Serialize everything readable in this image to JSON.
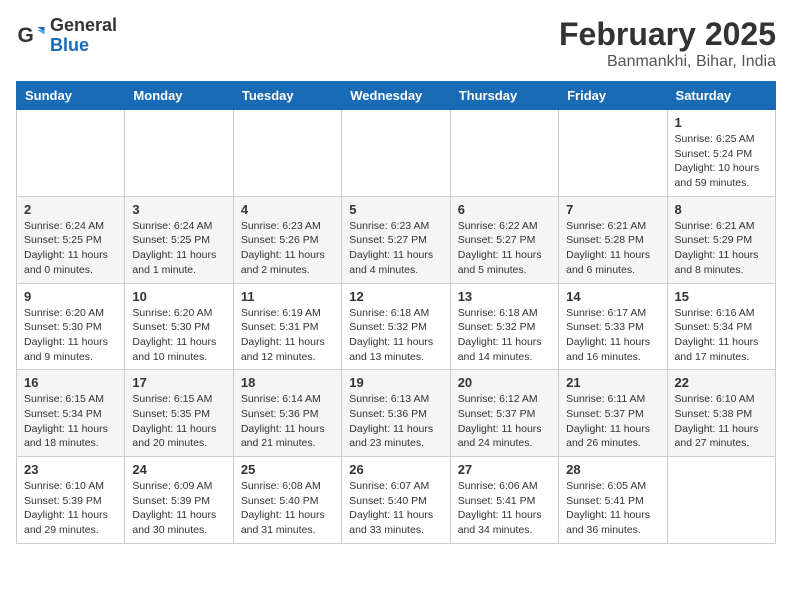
{
  "logo": {
    "general": "General",
    "blue": "Blue"
  },
  "header": {
    "month_year": "February 2025",
    "location": "Banmankhi, Bihar, India"
  },
  "weekdays": [
    "Sunday",
    "Monday",
    "Tuesday",
    "Wednesday",
    "Thursday",
    "Friday",
    "Saturday"
  ],
  "weeks": [
    [
      {
        "day": "",
        "info": ""
      },
      {
        "day": "",
        "info": ""
      },
      {
        "day": "",
        "info": ""
      },
      {
        "day": "",
        "info": ""
      },
      {
        "day": "",
        "info": ""
      },
      {
        "day": "",
        "info": ""
      },
      {
        "day": "1",
        "info": "Sunrise: 6:25 AM\nSunset: 5:24 PM\nDaylight: 10 hours\nand 59 minutes."
      }
    ],
    [
      {
        "day": "2",
        "info": "Sunrise: 6:24 AM\nSunset: 5:25 PM\nDaylight: 11 hours\nand 0 minutes."
      },
      {
        "day": "3",
        "info": "Sunrise: 6:24 AM\nSunset: 5:25 PM\nDaylight: 11 hours\nand 1 minute."
      },
      {
        "day": "4",
        "info": "Sunrise: 6:23 AM\nSunset: 5:26 PM\nDaylight: 11 hours\nand 2 minutes."
      },
      {
        "day": "5",
        "info": "Sunrise: 6:23 AM\nSunset: 5:27 PM\nDaylight: 11 hours\nand 4 minutes."
      },
      {
        "day": "6",
        "info": "Sunrise: 6:22 AM\nSunset: 5:27 PM\nDaylight: 11 hours\nand 5 minutes."
      },
      {
        "day": "7",
        "info": "Sunrise: 6:21 AM\nSunset: 5:28 PM\nDaylight: 11 hours\nand 6 minutes."
      },
      {
        "day": "8",
        "info": "Sunrise: 6:21 AM\nSunset: 5:29 PM\nDaylight: 11 hours\nand 8 minutes."
      }
    ],
    [
      {
        "day": "9",
        "info": "Sunrise: 6:20 AM\nSunset: 5:30 PM\nDaylight: 11 hours\nand 9 minutes."
      },
      {
        "day": "10",
        "info": "Sunrise: 6:20 AM\nSunset: 5:30 PM\nDaylight: 11 hours\nand 10 minutes."
      },
      {
        "day": "11",
        "info": "Sunrise: 6:19 AM\nSunset: 5:31 PM\nDaylight: 11 hours\nand 12 minutes."
      },
      {
        "day": "12",
        "info": "Sunrise: 6:18 AM\nSunset: 5:32 PM\nDaylight: 11 hours\nand 13 minutes."
      },
      {
        "day": "13",
        "info": "Sunrise: 6:18 AM\nSunset: 5:32 PM\nDaylight: 11 hours\nand 14 minutes."
      },
      {
        "day": "14",
        "info": "Sunrise: 6:17 AM\nSunset: 5:33 PM\nDaylight: 11 hours\nand 16 minutes."
      },
      {
        "day": "15",
        "info": "Sunrise: 6:16 AM\nSunset: 5:34 PM\nDaylight: 11 hours\nand 17 minutes."
      }
    ],
    [
      {
        "day": "16",
        "info": "Sunrise: 6:15 AM\nSunset: 5:34 PM\nDaylight: 11 hours\nand 18 minutes."
      },
      {
        "day": "17",
        "info": "Sunrise: 6:15 AM\nSunset: 5:35 PM\nDaylight: 11 hours\nand 20 minutes."
      },
      {
        "day": "18",
        "info": "Sunrise: 6:14 AM\nSunset: 5:36 PM\nDaylight: 11 hours\nand 21 minutes."
      },
      {
        "day": "19",
        "info": "Sunrise: 6:13 AM\nSunset: 5:36 PM\nDaylight: 11 hours\nand 23 minutes."
      },
      {
        "day": "20",
        "info": "Sunrise: 6:12 AM\nSunset: 5:37 PM\nDaylight: 11 hours\nand 24 minutes."
      },
      {
        "day": "21",
        "info": "Sunrise: 6:11 AM\nSunset: 5:37 PM\nDaylight: 11 hours\nand 26 minutes."
      },
      {
        "day": "22",
        "info": "Sunrise: 6:10 AM\nSunset: 5:38 PM\nDaylight: 11 hours\nand 27 minutes."
      }
    ],
    [
      {
        "day": "23",
        "info": "Sunrise: 6:10 AM\nSunset: 5:39 PM\nDaylight: 11 hours\nand 29 minutes."
      },
      {
        "day": "24",
        "info": "Sunrise: 6:09 AM\nSunset: 5:39 PM\nDaylight: 11 hours\nand 30 minutes."
      },
      {
        "day": "25",
        "info": "Sunrise: 6:08 AM\nSunset: 5:40 PM\nDaylight: 11 hours\nand 31 minutes."
      },
      {
        "day": "26",
        "info": "Sunrise: 6:07 AM\nSunset: 5:40 PM\nDaylight: 11 hours\nand 33 minutes."
      },
      {
        "day": "27",
        "info": "Sunrise: 6:06 AM\nSunset: 5:41 PM\nDaylight: 11 hours\nand 34 minutes."
      },
      {
        "day": "28",
        "info": "Sunrise: 6:05 AM\nSunset: 5:41 PM\nDaylight: 11 hours\nand 36 minutes."
      },
      {
        "day": "",
        "info": ""
      }
    ]
  ]
}
